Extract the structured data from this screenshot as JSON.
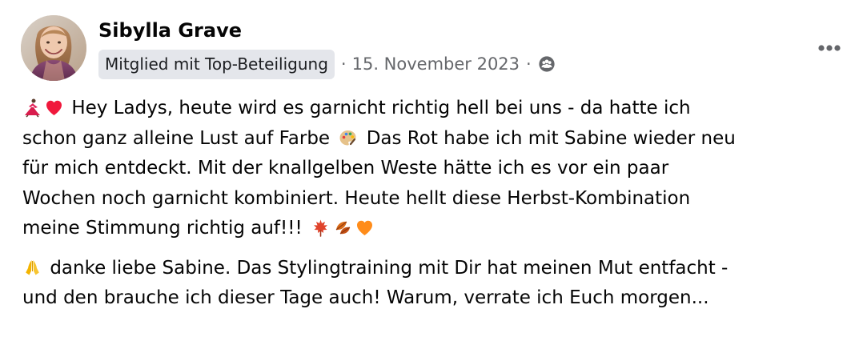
{
  "post": {
    "author": {
      "name": "Sibylla Grave",
      "badge": "Mitglied mit Top-Beteiligung",
      "timestamp": "15. November 2023",
      "audience_icon": "group-icon"
    },
    "more_button_icon": "ellipsis-icon",
    "paragraphs": [
      {
        "lines": [
          "Hey Ladys, heute wird es garnicht richtig hell bei uns - da hatte ich",
          "schon ganz alleine Lust auf Farbe",
          "Das Rot habe ich mit Sabine wieder neu",
          "für mich entdeckt. Mit der knallgelben Weste hätte ich es vor ein paar",
          "Wochen noch garnicht kombiniert. Heute hellt diese Herbst-Kombination",
          "meine Stimmung richtig auf!!!"
        ]
      },
      {
        "lines": [
          "danke liebe Sabine. Das Stylingtraining mit Dir hat meinen Mut entfacht -",
          "und den brauche ich dieser Tage auch! Warum, verrate ich Euch morgen..."
        ]
      }
    ],
    "emoji": {
      "dancer": "dancer-icon",
      "heart_red": "red-heart-icon",
      "palette": "palette-icon",
      "maple_leaf": "maple-leaf-icon",
      "fallen_leaves": "fallen-leaves-icon",
      "heart_orange": "orange-heart-icon",
      "folded_hands": "folded-hands-icon"
    }
  },
  "colors": {
    "text": "#050505",
    "secondary": "#65676b",
    "badge_bg": "#e4e6eb"
  }
}
